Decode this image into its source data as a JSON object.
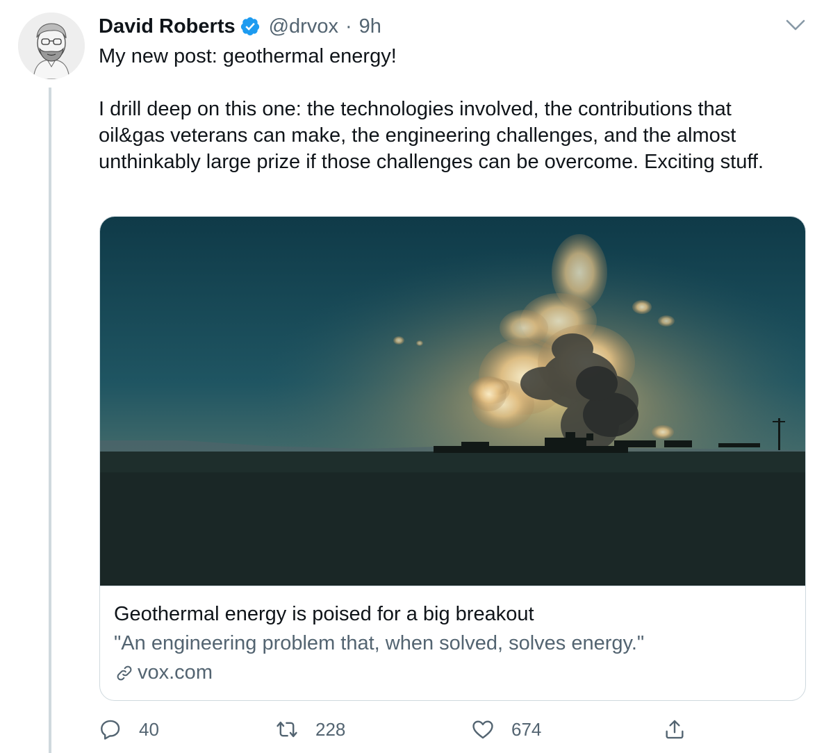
{
  "tweet": {
    "author": {
      "name": "David Roberts",
      "handle": "@drvox",
      "separator": "·",
      "time": "9h",
      "avatar_icon": "avatar-sketch"
    },
    "text": {
      "paragraph_1": "My new post: geothermal energy!",
      "paragraph_2": "I drill deep on this one: the technologies involved, the contributions that oil&gas veterans can make, the engineering challenges, and the almost unthinkably large prize if those challenges can be overcome. Exciting stuff."
    },
    "card": {
      "title": "Geothermal energy is poised for a big breakout",
      "description": "\"An engineering problem that, when solved, solves energy.\"",
      "domain": "vox.com",
      "image_icon": "geothermal-plant-steam-photo"
    },
    "actions": {
      "replies": "40",
      "retweets": "228",
      "likes": "674"
    },
    "colors": {
      "verified": "#1d9bf0",
      "secondary_text": "#536471",
      "border": "#cfd9de"
    }
  }
}
